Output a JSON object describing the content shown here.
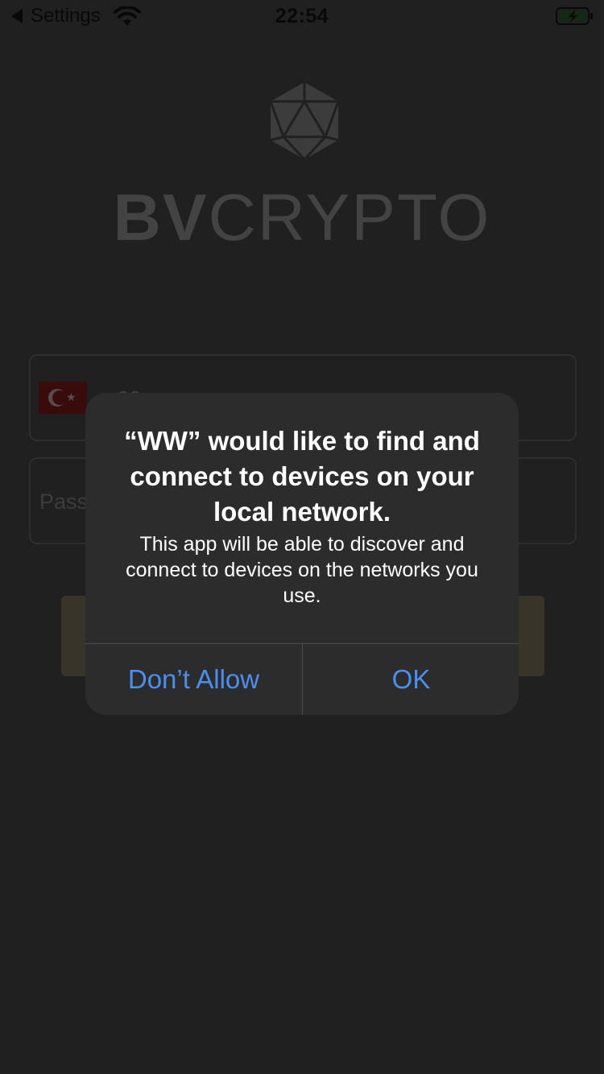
{
  "status_bar": {
    "back_label": "Settings",
    "time": "22:54",
    "icons": [
      "back-arrow-icon",
      "wifi-icon",
      "battery-charging-icon"
    ]
  },
  "brand": {
    "bold": "BV",
    "light": "CRYPTO"
  },
  "form": {
    "phone_value": "90",
    "password_placeholder": "Pass",
    "flag": "turkey-flag-icon"
  },
  "alert": {
    "title": "“WW” would like to find and connect to devices on your local network.",
    "message": "This app will be able to discover and connect to devices on the networks you use.",
    "deny_label": "Don’t Allow",
    "ok_label": "OK"
  },
  "colors": {
    "alert_button": "#4a8ff0",
    "background": "#3b3b3b",
    "login_button": "#67604b"
  }
}
